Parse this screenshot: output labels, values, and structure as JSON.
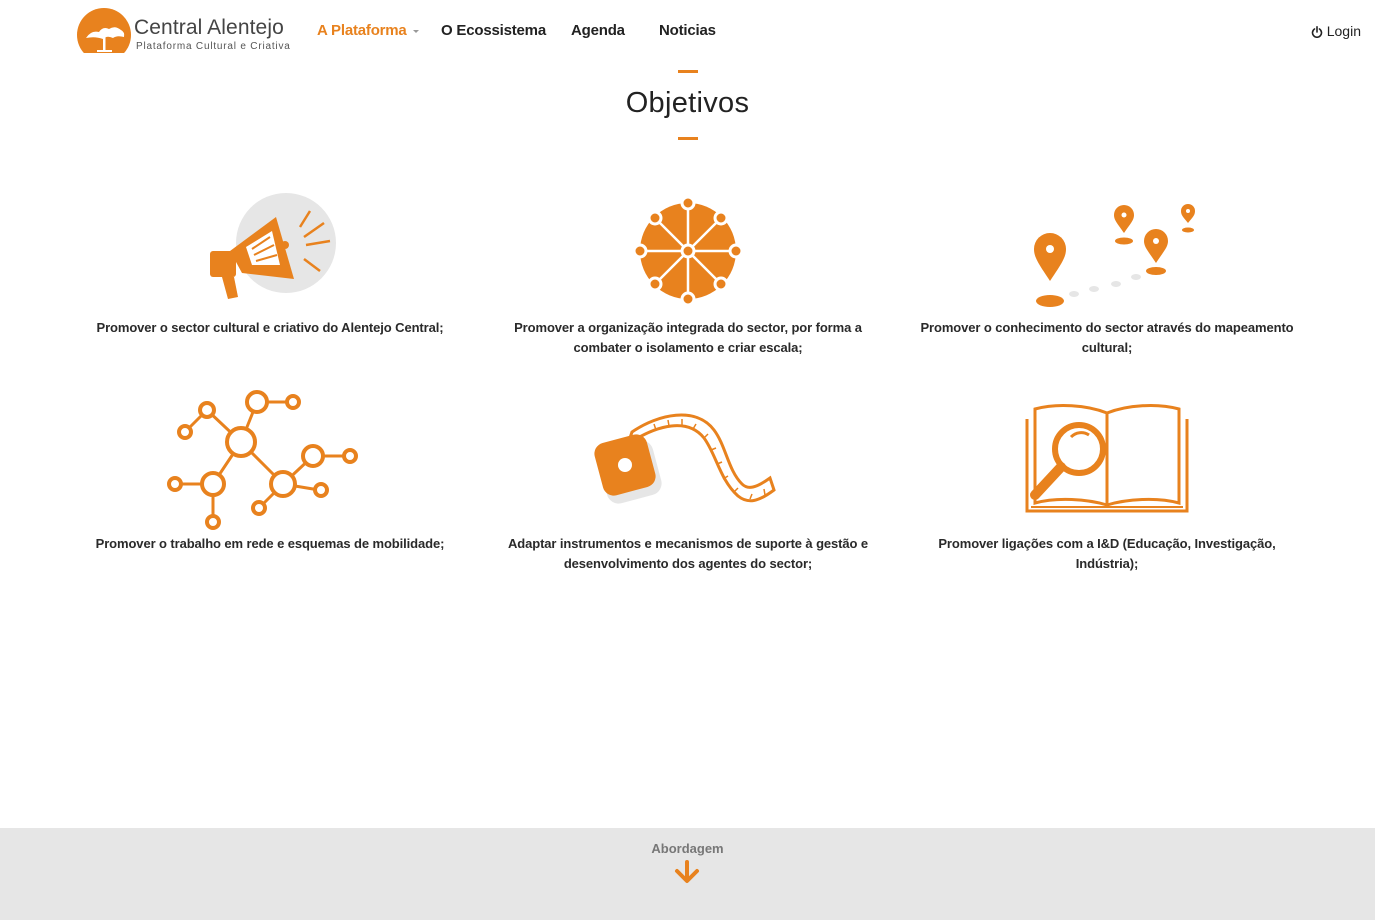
{
  "brand": {
    "title": "Central Alentejo",
    "subtitle": "Plataforma Cultural e Criativa",
    "accent": "#e8821e"
  },
  "nav": {
    "items": [
      {
        "label": "A Plataforma",
        "active": true,
        "dropdown": true
      },
      {
        "label": "O Ecossistema",
        "active": false
      },
      {
        "label": "Agenda",
        "active": false
      },
      {
        "label": "Noticias",
        "active": false
      }
    ],
    "login": {
      "label": "Login",
      "icon": "power-icon"
    }
  },
  "section": {
    "title": "Objetivos"
  },
  "objectives": [
    {
      "icon": "megaphone-icon",
      "text": "Promover o sector cultural e criativo do Alentejo Central;"
    },
    {
      "icon": "network-wheel-icon",
      "text": "Promover a organização integrada do sector, por forma a combater o isolamento e criar escala;"
    },
    {
      "icon": "map-pins-icon",
      "text": "Promover o conhecimento do sector através do mapeamento cultural;"
    },
    {
      "icon": "molecule-network-icon",
      "text": "Promover o trabalho em rede e esquemas de mobilidade;"
    },
    {
      "icon": "measuring-tape-icon",
      "text": "Adaptar instrumentos e mecanismos de suporte à gestão e desenvolvimento dos agentes do sector;"
    },
    {
      "icon": "book-magnifier-icon",
      "text": "Promover ligações com a I&D (Educação, Investigação, Indústria);"
    }
  ],
  "footer": {
    "link_label": "Abordagem",
    "icon": "arrow-down-icon"
  }
}
